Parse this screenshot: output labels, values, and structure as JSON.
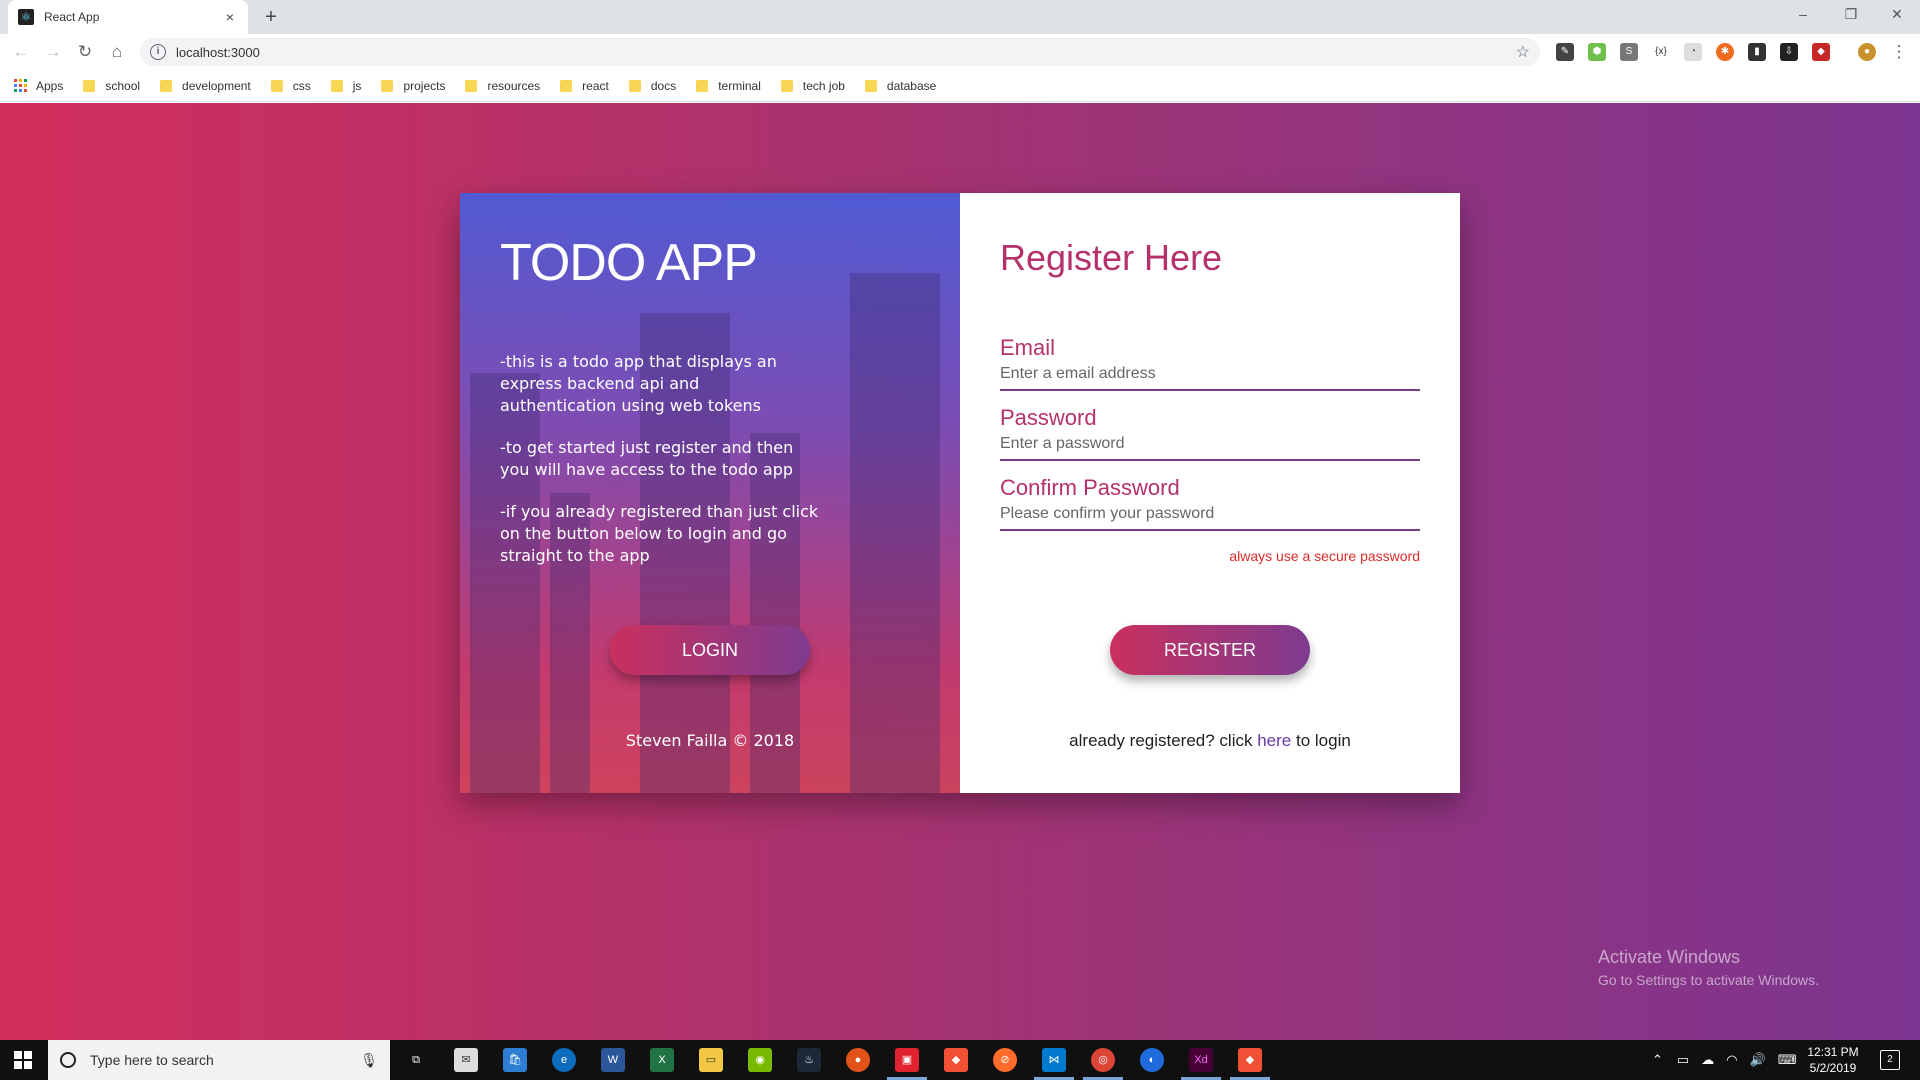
{
  "browser": {
    "tab_title": "React App",
    "tab_close": "×",
    "new_tab": "+",
    "url": "localhost:3000",
    "window_controls": {
      "minimize": "–",
      "restore": "❐",
      "close": "✕"
    },
    "bookmarks": [
      {
        "label": "Apps"
      },
      {
        "label": "school"
      },
      {
        "label": "development"
      },
      {
        "label": "css"
      },
      {
        "label": "js"
      },
      {
        "label": "projects"
      },
      {
        "label": "resources"
      },
      {
        "label": "react"
      },
      {
        "label": "docs"
      },
      {
        "label": "terminal"
      },
      {
        "label": "tech job"
      },
      {
        "label": "database"
      }
    ]
  },
  "left_panel": {
    "title": "TODO APP",
    "paragraphs": [
      "-this is a todo app that displays an express backend api and authentication using web tokens",
      "-to get started just register and then you will have access to the todo app",
      "-if you already registered than just click on the button below to login and go straight to the app"
    ],
    "login_label": "LOGIN",
    "footer": "Steven Failla © 2018"
  },
  "register": {
    "heading": "Register Here",
    "email_label": "Email",
    "email_placeholder": "Enter a email address",
    "password_label": "Password",
    "password_placeholder": "Enter a password",
    "confirm_label": "Confirm Password",
    "confirm_placeholder": "Please confirm your password",
    "hint": "always use a secure password",
    "register_label": "REGISTER",
    "already_prefix": "already registered? click",
    "already_link": "here",
    "already_suffix": "to login"
  },
  "watermark": {
    "line1": "Activate Windows",
    "line2": "Go to Settings to activate Windows."
  },
  "taskbar": {
    "search_placeholder": "Type here to search",
    "time": "12:31 PM",
    "date": "5/2/2019",
    "notification_count": "2"
  },
  "colors": {
    "gradient_start": "#d22e5c",
    "gradient_end": "#7c3590",
    "accent": "#b5316b",
    "hint": "#e02a2a",
    "link": "#6b3aa5"
  }
}
